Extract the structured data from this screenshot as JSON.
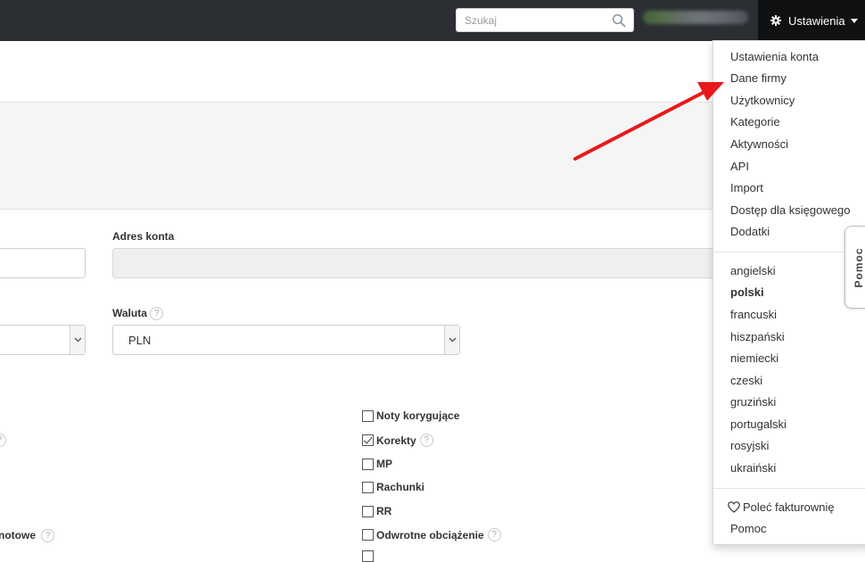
{
  "header": {
    "search_placeholder": "Szukaj",
    "search_icon": "search-icon",
    "settings_label": "Ustawienia",
    "settings_icon": "gear-icon"
  },
  "form": {
    "adres_konta_label": "Adres konta",
    "waluta_label": "Waluta",
    "waluta_value": "PLN",
    "left_fragment_label": "notowe",
    "help_glyph": "?"
  },
  "checkboxes": [
    {
      "label": "Noty korygujące",
      "checked": false,
      "help": false
    },
    {
      "label": "Korekty",
      "checked": true,
      "help": true
    },
    {
      "label": "MP",
      "checked": false,
      "help": false
    },
    {
      "label": "Rachunki",
      "checked": false,
      "help": false
    },
    {
      "label": "RR",
      "checked": false,
      "help": false
    },
    {
      "label": "Odwrotne obciążenie",
      "checked": false,
      "help": true
    }
  ],
  "settings_menu": {
    "account_items": [
      "Ustawienia konta",
      "Dane firmy",
      "Użytkownicy",
      "Kategorie",
      "Aktywności",
      "API",
      "Import",
      "Dostęp dla księgowego",
      "Dodatki"
    ],
    "languages": [
      "angielski",
      "polski",
      "francuski",
      "hiszpański",
      "niemiecki",
      "czeski",
      "gruziński",
      "portugalski",
      "rosyjski",
      "ukraiński"
    ],
    "active_language": "polski",
    "recommend_label": "Poleć fakturownię",
    "recommend_icon": "heart-icon",
    "help_label": "Pomoc"
  },
  "help_tab": {
    "label": "Pomoc"
  },
  "colors": {
    "topbar": "#2b2e33",
    "settings_button": "#101113",
    "annotation_arrow": "#e8191b"
  }
}
